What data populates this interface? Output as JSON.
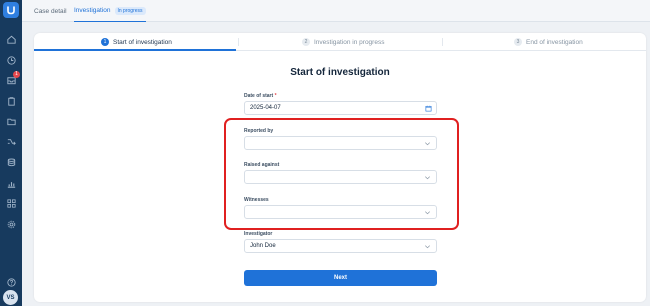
{
  "sidebar": {
    "notification_count": "1",
    "avatar_initials": "VS",
    "icons": [
      "home-icon",
      "clock-icon",
      "inbox-icon",
      "clipboard-icon",
      "folder-icon",
      "shuffle-icon",
      "database-icon",
      "chart-icon",
      "apps-icon",
      "settings-icon",
      "help-icon"
    ]
  },
  "tabs": {
    "case_detail": "Case detail",
    "investigation": "Investigation",
    "investigation_status": "In progress"
  },
  "stepper": {
    "steps": [
      {
        "number": "1",
        "label": "Start of investigation"
      },
      {
        "number": "2",
        "label": "Investigation in progress"
      },
      {
        "number": "3",
        "label": "End of investigation"
      }
    ]
  },
  "form": {
    "title": "Start of investigation",
    "date_label": "Date of start",
    "date_required": "*",
    "date_value": "2025-04-07",
    "reported_by_label": "Reported by",
    "reported_by_value": "",
    "raised_against_label": "Raised against",
    "raised_against_value": "",
    "witnesses_label": "Witnesses",
    "witnesses_value": "",
    "investigator_label": "Investigator",
    "investigator_value": "John Doe",
    "next_label": "Next"
  },
  "colors": {
    "accent": "#1f72d8",
    "sidebar": "#173a5e",
    "highlight": "#e02020"
  }
}
